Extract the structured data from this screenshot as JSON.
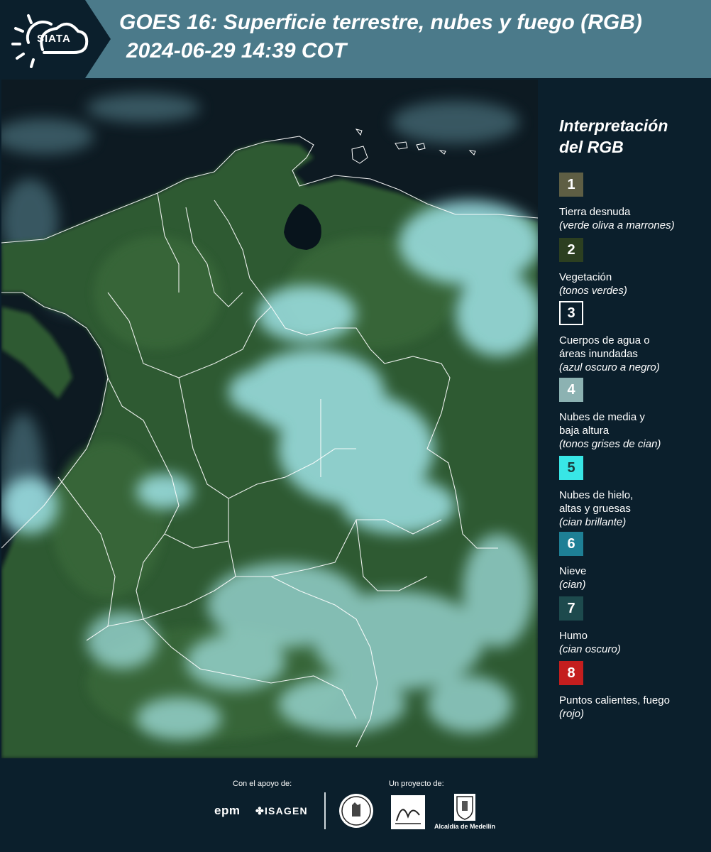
{
  "header": {
    "logo_text": "SIATA",
    "title": "GOES 16: Superficie terrestre, nubes y fuego (RGB)",
    "subtitle": "2024-06-29 14:39 COT"
  },
  "map": {
    "icon": "satellite-rgb-composite-colombia",
    "colors": {
      "ocean": "#0d1a22",
      "vegetation": "#2f5a32",
      "clouds": "#9fe3e6",
      "borders": "#ffffff"
    }
  },
  "legend": {
    "title": "Interpretación\ndel RGB",
    "items": [
      {
        "number": "1",
        "label": "Tierra desnuda",
        "note": "(verde oliva a marrones)",
        "color": "#5e5e44",
        "text_color": "#ffffff"
      },
      {
        "number": "2",
        "label": "Vegetación",
        "note": "(tonos verdes)",
        "color": "#2c3f20",
        "text_color": "#ffffff"
      },
      {
        "number": "3",
        "label": "Cuerpos de agua o\náreas inundadas",
        "note": "(azul oscuro a negro)",
        "color": "#0b1f2c",
        "text_color": "#ffffff",
        "bordered": true
      },
      {
        "number": "4",
        "label": "Nubes de media y\nbaja altura",
        "note": "(tonos grises de cian)",
        "color": "#8cb2b2",
        "text_color": "#ffffff"
      },
      {
        "number": "5",
        "label": "Nubes de hielo,\naltas y gruesas",
        "note": "(cian brillante)",
        "color": "#38e6e6",
        "text_color": "#1a3a3a"
      },
      {
        "number": "6",
        "label": "Nieve",
        "note": "(cian)",
        "color": "#1e7f95",
        "text_color": "#ffffff"
      },
      {
        "number": "7",
        "label": "Humo",
        "note": "(cian oscuro)",
        "color": "#1d4a4d",
        "text_color": "#ffffff"
      },
      {
        "number": "8",
        "label": "Puntos calientes, fuego",
        "note": "(rojo)",
        "color": "#c41e1e",
        "text_color": "#ffffff"
      }
    ]
  },
  "footer": {
    "support_label": "Con el apoyo de:",
    "project_label": "Un proyecto de:",
    "sponsors": [
      "epm",
      "ISAGEN"
    ],
    "medellin_label": "Alcaldía de Medellín"
  }
}
